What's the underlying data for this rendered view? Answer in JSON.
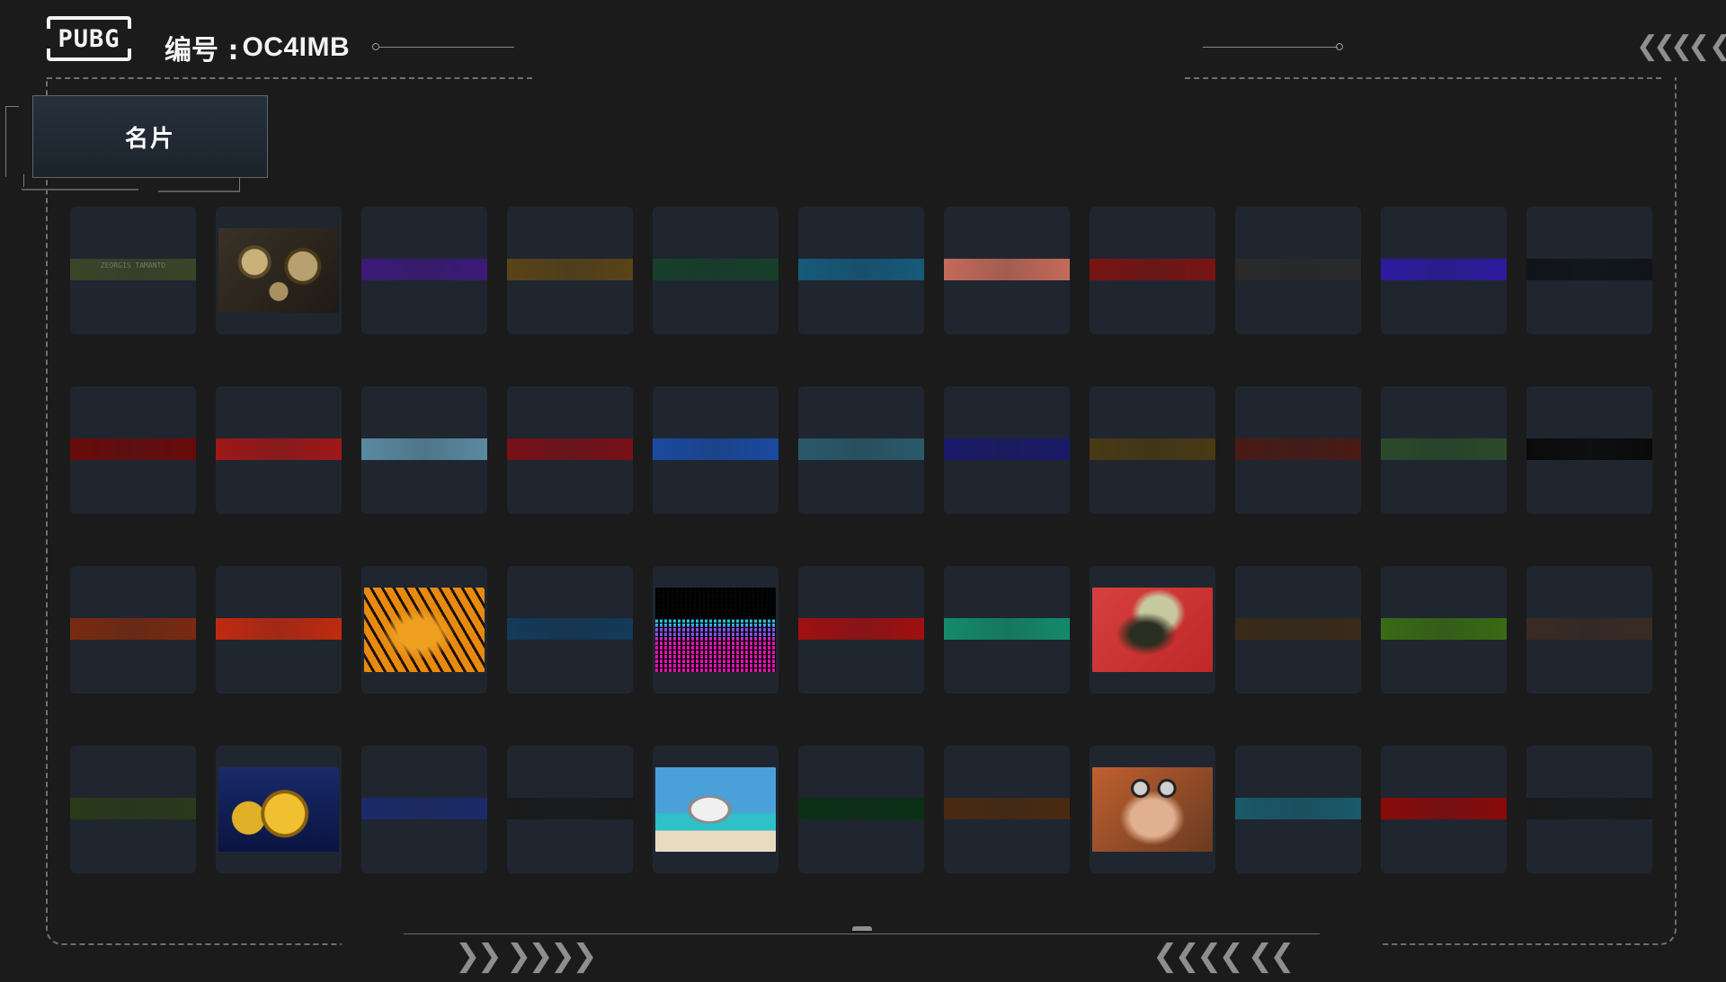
{
  "header": {
    "logo_text": "PUBG",
    "serial_label": "编号 :",
    "serial_value": "OC4IMB",
    "top_right_chevrons": "❮❮❮❮ ❮"
  },
  "tab": {
    "label": "名片"
  },
  "footer": {
    "left_chevrons": "❯❯ ❯❯❯❯",
    "right_chevrons": "❮❮❮❮ ❮❮"
  },
  "cards": [
    {
      "strip": "#3a4628",
      "label": "ZEORGIS\nTAMANTO"
    },
    {
      "art": "gears"
    },
    {
      "strip": "#3b1a78"
    },
    {
      "strip": "#5a4418"
    },
    {
      "strip": "#17402a"
    },
    {
      "strip": "#165a7a"
    },
    {
      "strip": "#c46a5a"
    },
    {
      "strip": "#7a1414"
    },
    {
      "strip": "#2a2a2a"
    },
    {
      "strip": "#2d1aa0"
    },
    {
      "strip": "#101418"
    },
    {
      "strip": "#6a0a0a"
    },
    {
      "strip": "#a01818"
    },
    {
      "strip": "#5a8aa0"
    },
    {
      "strip": "#7a1018"
    },
    {
      "strip": "#1a4aa0"
    },
    {
      "strip": "#2a5a6a"
    },
    {
      "strip": "#1a1a6a"
    },
    {
      "strip": "#4a3a14"
    },
    {
      "strip": "#4a1a14"
    },
    {
      "strip": "#2a4a2a"
    },
    {
      "strip": "#0a0a0a"
    },
    {
      "strip": "#7a2a10"
    },
    {
      "strip": "#c02a10"
    },
    {
      "art": "tiger"
    },
    {
      "strip": "#143a5a"
    },
    {
      "art": "equalizer"
    },
    {
      "strip": "#a01010"
    },
    {
      "strip": "#148a6a"
    },
    {
      "art": "masked"
    },
    {
      "strip": "#3a2a18"
    },
    {
      "strip": "#3a6a14"
    },
    {
      "strip": "#3a2a24"
    },
    {
      "strip": "#2a3a1a"
    },
    {
      "art": "gold88"
    },
    {
      "strip": "#1a2a6a"
    },
    {
      "strip": "#1a1a1a"
    },
    {
      "art": "seagull"
    },
    {
      "strip": "#0a3014"
    },
    {
      "strip": "#4a2a10"
    },
    {
      "art": "goggles"
    },
    {
      "strip": "#1a5a6a"
    },
    {
      "strip": "#8a0a0a"
    },
    {
      "strip": "#1a1a1a"
    }
  ]
}
